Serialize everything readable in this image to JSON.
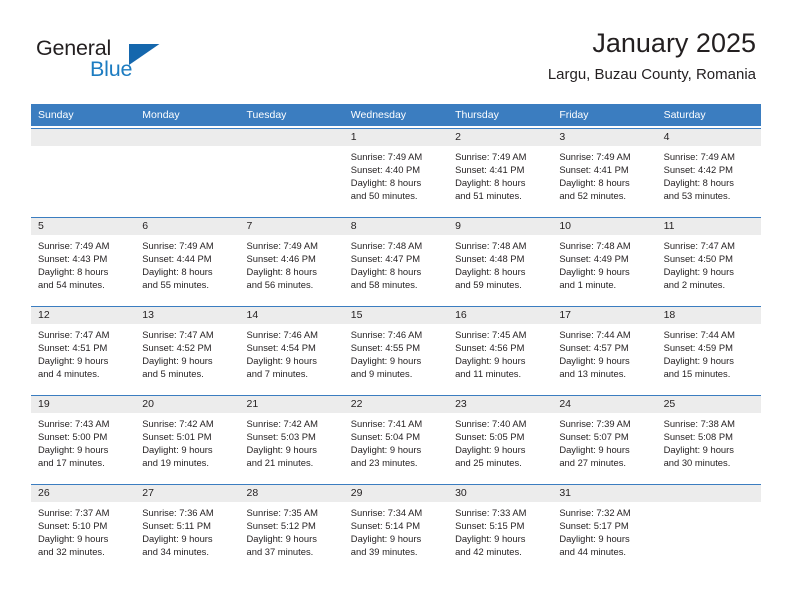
{
  "brand": {
    "name_part1": "General",
    "name_part2": "Blue",
    "triangle_color": "#1567ad",
    "blue_color": "#1d7cc1"
  },
  "header": {
    "title": "January 2025",
    "subtitle": "Largu, Buzau County, Romania"
  },
  "calendar": {
    "header_bg": "#3b7dc0",
    "day_band_bg": "#ececec",
    "weekday_names": [
      "Sunday",
      "Monday",
      "Tuesday",
      "Wednesday",
      "Thursday",
      "Friday",
      "Saturday"
    ],
    "weeks": [
      [
        {
          "day": "",
          "empty": true
        },
        {
          "day": "",
          "empty": true
        },
        {
          "day": "",
          "empty": true
        },
        {
          "day": "1",
          "sunrise": "Sunrise: 7:49 AM",
          "sunset": "Sunset: 4:40 PM",
          "daylight1": "Daylight: 8 hours",
          "daylight2": "and 50 minutes."
        },
        {
          "day": "2",
          "sunrise": "Sunrise: 7:49 AM",
          "sunset": "Sunset: 4:41 PM",
          "daylight1": "Daylight: 8 hours",
          "daylight2": "and 51 minutes."
        },
        {
          "day": "3",
          "sunrise": "Sunrise: 7:49 AM",
          "sunset": "Sunset: 4:41 PM",
          "daylight1": "Daylight: 8 hours",
          "daylight2": "and 52 minutes."
        },
        {
          "day": "4",
          "sunrise": "Sunrise: 7:49 AM",
          "sunset": "Sunset: 4:42 PM",
          "daylight1": "Daylight: 8 hours",
          "daylight2": "and 53 minutes."
        }
      ],
      [
        {
          "day": "5",
          "sunrise": "Sunrise: 7:49 AM",
          "sunset": "Sunset: 4:43 PM",
          "daylight1": "Daylight: 8 hours",
          "daylight2": "and 54 minutes."
        },
        {
          "day": "6",
          "sunrise": "Sunrise: 7:49 AM",
          "sunset": "Sunset: 4:44 PM",
          "daylight1": "Daylight: 8 hours",
          "daylight2": "and 55 minutes."
        },
        {
          "day": "7",
          "sunrise": "Sunrise: 7:49 AM",
          "sunset": "Sunset: 4:46 PM",
          "daylight1": "Daylight: 8 hours",
          "daylight2": "and 56 minutes."
        },
        {
          "day": "8",
          "sunrise": "Sunrise: 7:48 AM",
          "sunset": "Sunset: 4:47 PM",
          "daylight1": "Daylight: 8 hours",
          "daylight2": "and 58 minutes."
        },
        {
          "day": "9",
          "sunrise": "Sunrise: 7:48 AM",
          "sunset": "Sunset: 4:48 PM",
          "daylight1": "Daylight: 8 hours",
          "daylight2": "and 59 minutes."
        },
        {
          "day": "10",
          "sunrise": "Sunrise: 7:48 AM",
          "sunset": "Sunset: 4:49 PM",
          "daylight1": "Daylight: 9 hours",
          "daylight2": "and 1 minute."
        },
        {
          "day": "11",
          "sunrise": "Sunrise: 7:47 AM",
          "sunset": "Sunset: 4:50 PM",
          "daylight1": "Daylight: 9 hours",
          "daylight2": "and 2 minutes."
        }
      ],
      [
        {
          "day": "12",
          "sunrise": "Sunrise: 7:47 AM",
          "sunset": "Sunset: 4:51 PM",
          "daylight1": "Daylight: 9 hours",
          "daylight2": "and 4 minutes."
        },
        {
          "day": "13",
          "sunrise": "Sunrise: 7:47 AM",
          "sunset": "Sunset: 4:52 PM",
          "daylight1": "Daylight: 9 hours",
          "daylight2": "and 5 minutes."
        },
        {
          "day": "14",
          "sunrise": "Sunrise: 7:46 AM",
          "sunset": "Sunset: 4:54 PM",
          "daylight1": "Daylight: 9 hours",
          "daylight2": "and 7 minutes."
        },
        {
          "day": "15",
          "sunrise": "Sunrise: 7:46 AM",
          "sunset": "Sunset: 4:55 PM",
          "daylight1": "Daylight: 9 hours",
          "daylight2": "and 9 minutes."
        },
        {
          "day": "16",
          "sunrise": "Sunrise: 7:45 AM",
          "sunset": "Sunset: 4:56 PM",
          "daylight1": "Daylight: 9 hours",
          "daylight2": "and 11 minutes."
        },
        {
          "day": "17",
          "sunrise": "Sunrise: 7:44 AM",
          "sunset": "Sunset: 4:57 PM",
          "daylight1": "Daylight: 9 hours",
          "daylight2": "and 13 minutes."
        },
        {
          "day": "18",
          "sunrise": "Sunrise: 7:44 AM",
          "sunset": "Sunset: 4:59 PM",
          "daylight1": "Daylight: 9 hours",
          "daylight2": "and 15 minutes."
        }
      ],
      [
        {
          "day": "19",
          "sunrise": "Sunrise: 7:43 AM",
          "sunset": "Sunset: 5:00 PM",
          "daylight1": "Daylight: 9 hours",
          "daylight2": "and 17 minutes."
        },
        {
          "day": "20",
          "sunrise": "Sunrise: 7:42 AM",
          "sunset": "Sunset: 5:01 PM",
          "daylight1": "Daylight: 9 hours",
          "daylight2": "and 19 minutes."
        },
        {
          "day": "21",
          "sunrise": "Sunrise: 7:42 AM",
          "sunset": "Sunset: 5:03 PM",
          "daylight1": "Daylight: 9 hours",
          "daylight2": "and 21 minutes."
        },
        {
          "day": "22",
          "sunrise": "Sunrise: 7:41 AM",
          "sunset": "Sunset: 5:04 PM",
          "daylight1": "Daylight: 9 hours",
          "daylight2": "and 23 minutes."
        },
        {
          "day": "23",
          "sunrise": "Sunrise: 7:40 AM",
          "sunset": "Sunset: 5:05 PM",
          "daylight1": "Daylight: 9 hours",
          "daylight2": "and 25 minutes."
        },
        {
          "day": "24",
          "sunrise": "Sunrise: 7:39 AM",
          "sunset": "Sunset: 5:07 PM",
          "daylight1": "Daylight: 9 hours",
          "daylight2": "and 27 minutes."
        },
        {
          "day": "25",
          "sunrise": "Sunrise: 7:38 AM",
          "sunset": "Sunset: 5:08 PM",
          "daylight1": "Daylight: 9 hours",
          "daylight2": "and 30 minutes."
        }
      ],
      [
        {
          "day": "26",
          "sunrise": "Sunrise: 7:37 AM",
          "sunset": "Sunset: 5:10 PM",
          "daylight1": "Daylight: 9 hours",
          "daylight2": "and 32 minutes."
        },
        {
          "day": "27",
          "sunrise": "Sunrise: 7:36 AM",
          "sunset": "Sunset: 5:11 PM",
          "daylight1": "Daylight: 9 hours",
          "daylight2": "and 34 minutes."
        },
        {
          "day": "28",
          "sunrise": "Sunrise: 7:35 AM",
          "sunset": "Sunset: 5:12 PM",
          "daylight1": "Daylight: 9 hours",
          "daylight2": "and 37 minutes."
        },
        {
          "day": "29",
          "sunrise": "Sunrise: 7:34 AM",
          "sunset": "Sunset: 5:14 PM",
          "daylight1": "Daylight: 9 hours",
          "daylight2": "and 39 minutes."
        },
        {
          "day": "30",
          "sunrise": "Sunrise: 7:33 AM",
          "sunset": "Sunset: 5:15 PM",
          "daylight1": "Daylight: 9 hours",
          "daylight2": "and 42 minutes."
        },
        {
          "day": "31",
          "sunrise": "Sunrise: 7:32 AM",
          "sunset": "Sunset: 5:17 PM",
          "daylight1": "Daylight: 9 hours",
          "daylight2": "and 44 minutes."
        },
        {
          "day": "",
          "empty": true
        }
      ]
    ]
  }
}
